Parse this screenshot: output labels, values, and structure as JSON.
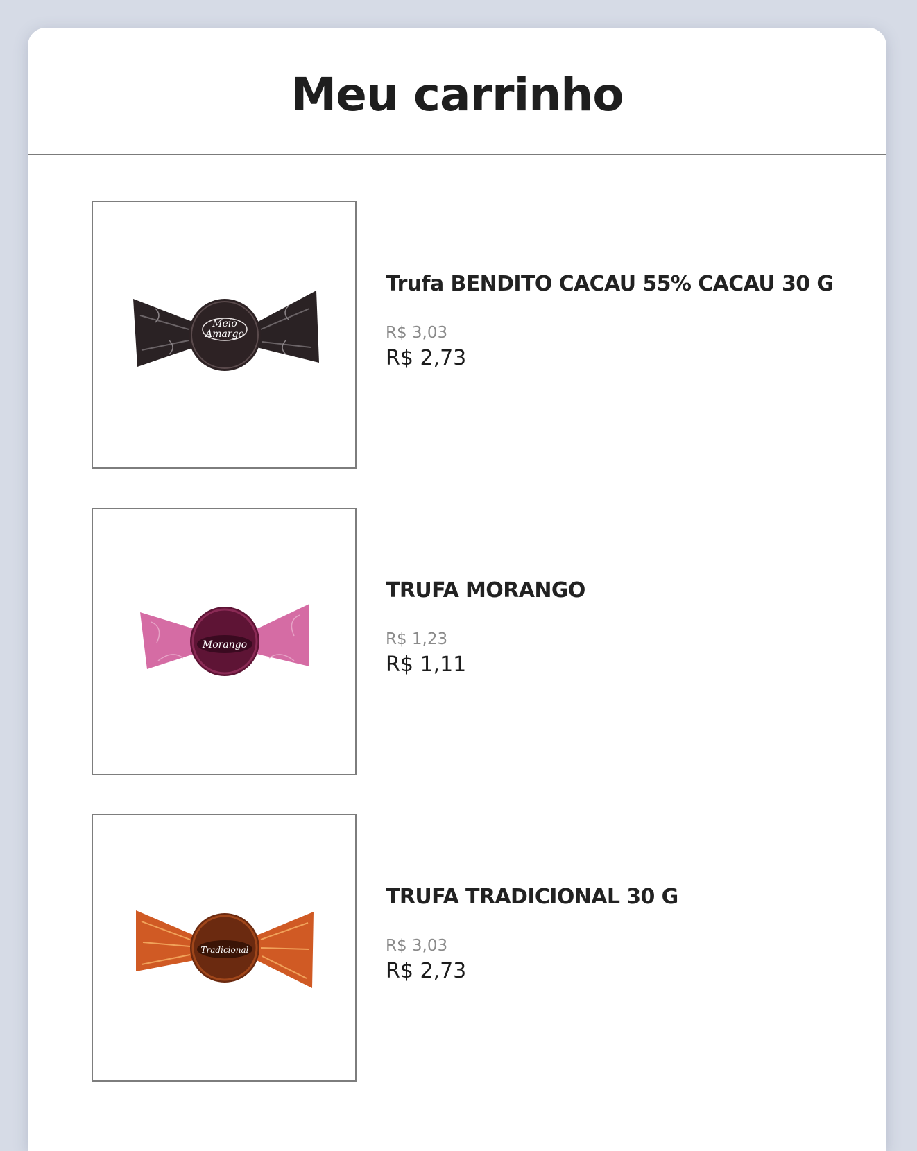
{
  "page": {
    "title": "Meu carrinho"
  },
  "cart": {
    "items": [
      {
        "name": "Trufa BENDITO CACAU 55% CACAU 30 G",
        "old_price": "R$ 3,03",
        "price": "R$ 2,73",
        "wrapper_text": [
          "Meio",
          "Amargo"
        ],
        "wrapper_color": "#2a2224",
        "accent_color": "#ffffff"
      },
      {
        "name": "TRUFA MORANGO",
        "old_price": "R$ 1,23",
        "price": "R$ 1,11",
        "wrapper_text": [
          "Morango"
        ],
        "wrapper_color": "#b3216a",
        "accent_color": "#ffffff"
      },
      {
        "name": "TRUFA TRADICIONAL 30 G",
        "old_price": "R$ 3,03",
        "price": "R$ 2,73",
        "wrapper_text": [
          "Tradicional"
        ],
        "wrapper_color": "#c4521c",
        "accent_color": "#ffffff"
      }
    ]
  }
}
